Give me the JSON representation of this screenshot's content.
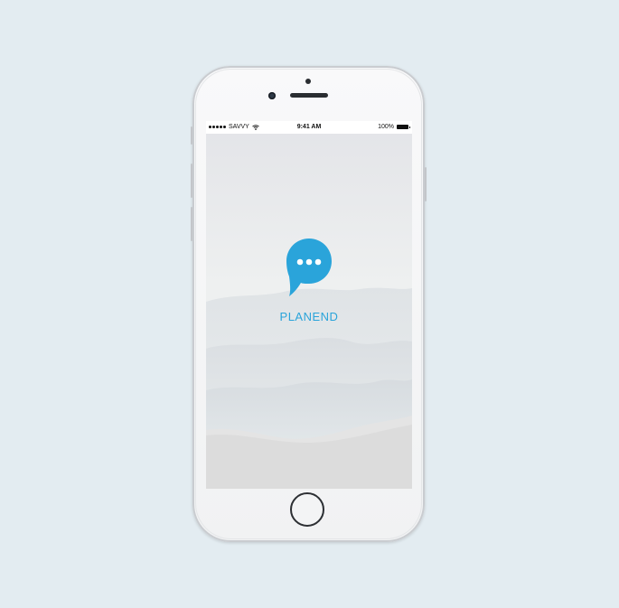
{
  "status_bar": {
    "carrier": "SAVVY",
    "time": "9:41 AM",
    "battery": "100%"
  },
  "splash": {
    "app_name": "PLANEND",
    "logo_icon": "chat-bubble-ellipsis-icon"
  },
  "colors": {
    "background": "#e3ecf1",
    "brand": "#2aa4da",
    "phone_body": "#f5f6f7"
  }
}
